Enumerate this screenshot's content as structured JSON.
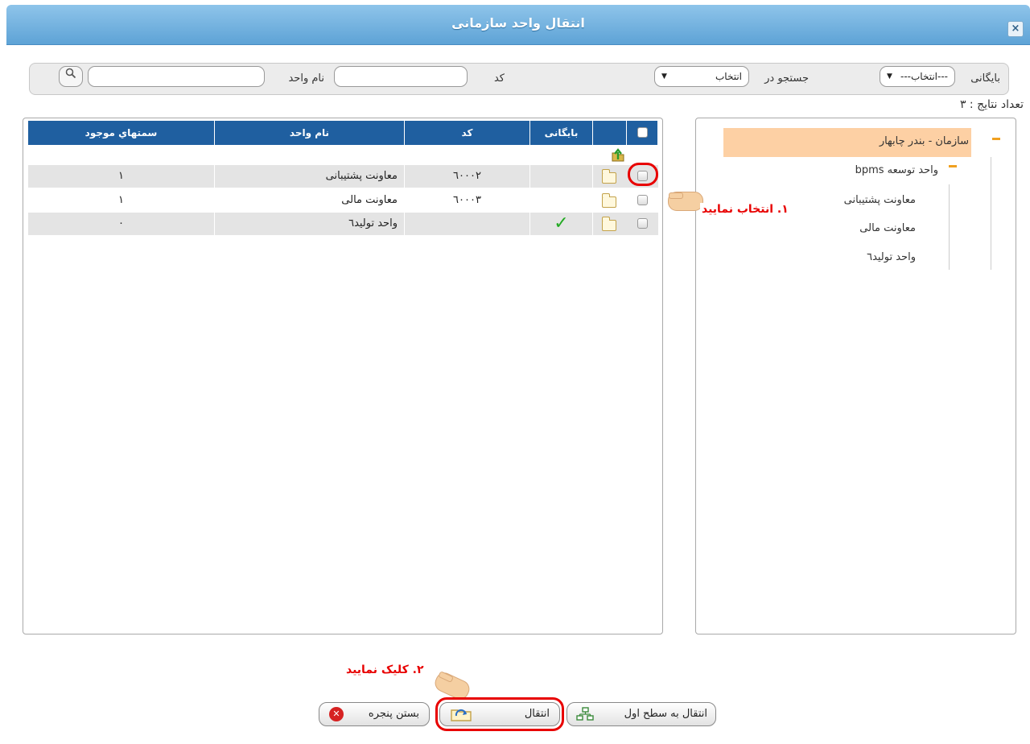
{
  "dialog": {
    "title": "انتقال واحد سازمانی",
    "close_icon": "×"
  },
  "search": {
    "archive_label": "بایگانی",
    "archive_value": "---انتخاب---",
    "search_in_label": "جستجو در",
    "search_in_value": "انتخاب",
    "code_label": "کد",
    "code_value": "",
    "unit_name_label": "نام واحد",
    "unit_name_value": ""
  },
  "results_count": "تعداد نتایج : ٣",
  "grid": {
    "columns": [
      "",
      "",
      "بایگانی",
      "کد",
      "نام واحد",
      "سمتهاي موجود"
    ],
    "rows": [
      {
        "archived": "",
        "code": "٦٠٠٠٢",
        "name": "معاونت پشتیبانی",
        "positions": "١"
      },
      {
        "archived": "",
        "code": "٦٠٠٠٣",
        "name": "معاونت مالی",
        "positions": "١"
      },
      {
        "archived": "✓",
        "code": "",
        "name": "واحد تولید٦",
        "positions": "٠"
      }
    ]
  },
  "tree": {
    "root": "سازمان - بندر چابهار",
    "child": "واحد توسعه bpms",
    "leaves": [
      "معاونت پشتیبانی",
      "معاونت مالی",
      "واحد تولید٦"
    ]
  },
  "annotations": {
    "step1": "١. انتخاب نمایید",
    "step2": "٢. کلیک نمایید"
  },
  "buttons": {
    "move_first_level": "انتقال به سطح اول",
    "move": "انتقال",
    "close_window": "بستن پنجره"
  },
  "colors": {
    "title_bar": "#6aaee0",
    "grid_header": "#1f5fa0",
    "tree_selected": "#fdd0a4",
    "annotation": "#e80000",
    "check": "#22aa22"
  }
}
